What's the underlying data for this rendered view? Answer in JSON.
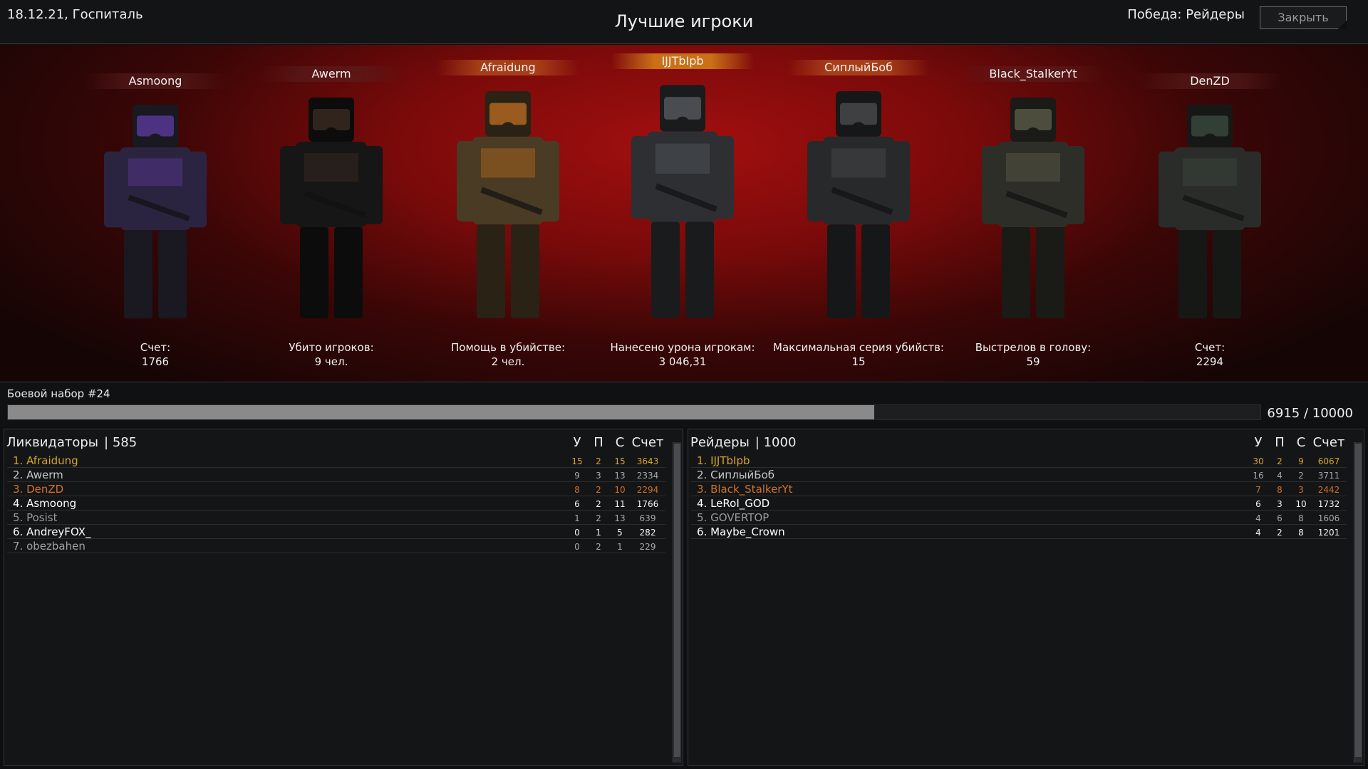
{
  "header": {
    "left": "18.12.21, Госпиталь",
    "title": "Лучшие игроки",
    "victory": "Победа: Рейдеры",
    "close_label": "Закрыть"
  },
  "hero_players": [
    {
      "name": "Asmoong",
      "stat_label": "Счет:",
      "stat_value": "1766",
      "highlight": "none"
    },
    {
      "name": "Awerm",
      "stat_label": "Убито игроков:",
      "stat_value": "9 чел.",
      "highlight": "none"
    },
    {
      "name": "Afraidung",
      "stat_label": "Помощь в убийстве:",
      "stat_value": "2 чел.",
      "highlight": "orange"
    },
    {
      "name": "IJJTbIpb",
      "stat_label": "Нанесено урона игрокам:",
      "stat_value": "3 046,31",
      "highlight": "gold"
    },
    {
      "name": "СиплыйБоб",
      "stat_label": "Максимальная серия убийств:",
      "stat_value": "15",
      "highlight": "orange"
    },
    {
      "name": "Black_StalkerYt",
      "stat_label": "Выстрелов в голову:",
      "stat_value": "59",
      "highlight": "none"
    },
    {
      "name": "DenZD",
      "stat_label": "Счет:",
      "stat_value": "2294",
      "highlight": "none"
    }
  ],
  "battle_pass": {
    "label": "Боевой набор #24",
    "progress_text": "6915 / 10000",
    "progress": 0.6915
  },
  "columns": {
    "k": "У",
    "a": "П",
    "d": "С",
    "score": "Счет"
  },
  "teams": [
    {
      "name": "Ликвидаторы",
      "score": "| 585",
      "rows": [
        {
          "name": "1. Afraidung",
          "k": "15",
          "a": "2",
          "d": "15",
          "score": "3643",
          "color": "#d6a52a"
        },
        {
          "name": "2. Awerm",
          "k": "9",
          "a": "3",
          "d": "13",
          "score": "2334",
          "color": "#c8c8c8"
        },
        {
          "name": "3. DenZD",
          "k": "8",
          "a": "2",
          "d": "10",
          "score": "2294",
          "color": "#d0712a"
        },
        {
          "name": "4. Asmoong",
          "k": "6",
          "a": "2",
          "d": "11",
          "score": "1766",
          "color": "#ffffff"
        },
        {
          "name": "5. Posist",
          "k": "1",
          "a": "2",
          "d": "13",
          "score": "639",
          "color": "#9a9a9a"
        },
        {
          "name": "6. AndreyFOX_",
          "k": "0",
          "a": "1",
          "d": "5",
          "score": "282",
          "color": "#ffffff"
        },
        {
          "name": "7. obezbahen",
          "k": "0",
          "a": "2",
          "d": "1",
          "score": "229",
          "color": "#a0a0a0"
        }
      ]
    },
    {
      "name": "Рейдеры",
      "score": "| 1000",
      "rows": [
        {
          "name": "1. IJJTbIpb",
          "k": "30",
          "a": "2",
          "d": "9",
          "score": "6067",
          "color": "#d6a52a"
        },
        {
          "name": "2. СиплыйБоб",
          "k": "16",
          "a": "4",
          "d": "2",
          "score": "3711",
          "color": "#c8c8c8"
        },
        {
          "name": "3. Black_StalkerYt",
          "k": "7",
          "a": "8",
          "d": "3",
          "score": "2442",
          "color": "#d0712a"
        },
        {
          "name": "4. LeRoI_GOD",
          "k": "6",
          "a": "3",
          "d": "10",
          "score": "1732",
          "color": "#ffffff"
        },
        {
          "name": "5. GOVERTOP",
          "k": "4",
          "a": "6",
          "d": "8",
          "score": "1606",
          "color": "#9a9a9a"
        },
        {
          "name": "6. Maybe_Crown",
          "k": "4",
          "a": "2",
          "d": "8",
          "score": "1201",
          "color": "#ffffff"
        }
      ]
    }
  ]
}
